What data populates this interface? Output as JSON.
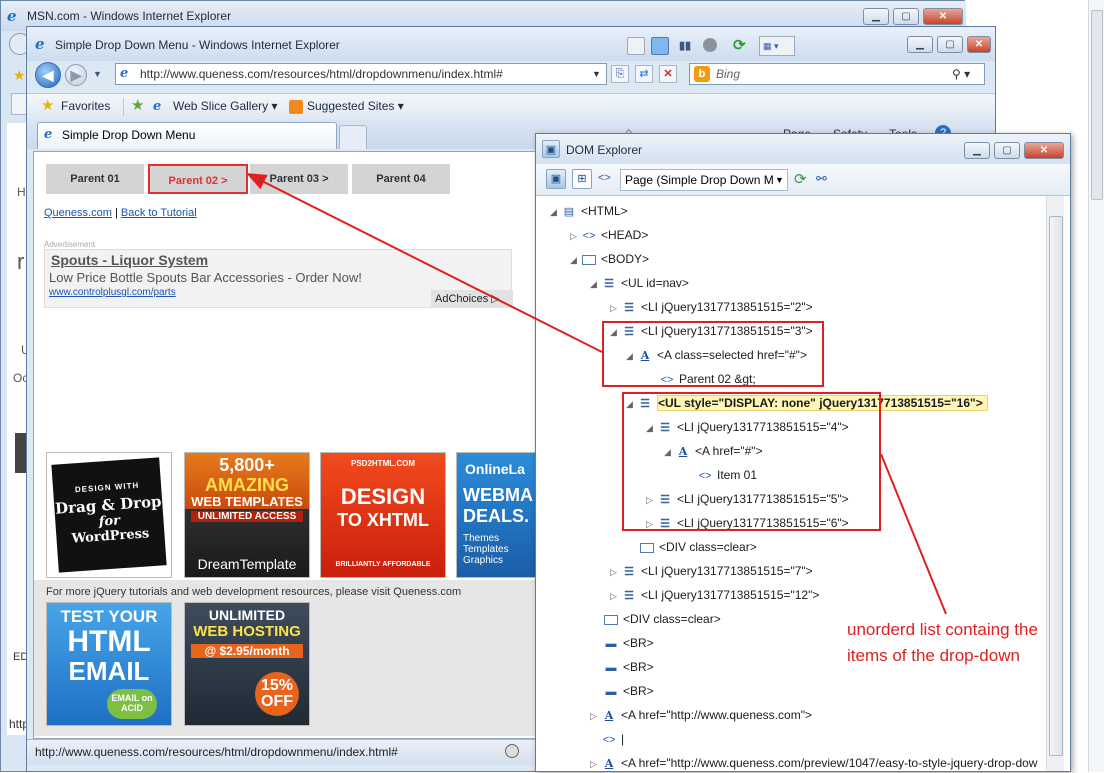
{
  "msn_window": {
    "title": "MSN.com - Windows Internet Explorer",
    "side_fragments": [
      "H",
      "r",
      "U",
      "Oc",
      "ED",
      "http"
    ]
  },
  "ie_window": {
    "title": "Simple Drop Down Menu - Windows Internet Explorer",
    "address": "http://www.queness.com/resources/html/dropdownmenu/index.html#",
    "search_placeholder": "Bing",
    "favorites_label": "Favorites",
    "web_slice_label": "Web Slice Gallery",
    "suggested_sites_label": "Suggested Sites",
    "tab_label": "Simple Drop Down Menu",
    "commandbar_fragments": [
      "Page",
      "Safety",
      "Tools"
    ],
    "status_url": "http://www.queness.com/resources/html/dropdownmenu/index.html#"
  },
  "page": {
    "menu": [
      "Parent 01",
      "Parent 02 >",
      "Parent 03 >",
      "Parent 04"
    ],
    "links": [
      "Queness.com",
      "Back to Tutorial"
    ],
    "link_separator": "|",
    "ad_label": "Advertisement",
    "ad": {
      "title": "Spouts - Liquor System",
      "description": "Low Price Bottle Spouts Bar Accessories - Order Now!",
      "url": "www.controlplusgl.com/parts",
      "choices": "AdChoices"
    },
    "banners": [
      {
        "top": "DESIGN WITH",
        "main": "Drag & Drop",
        "sub": "for",
        "foot": "WordPress"
      },
      {
        "top": "5,800+",
        "main": "AMAZING",
        "sub": "WEB TEMPLATES",
        "mid": "UNLIMITED ACCESS",
        "foot": "DreamTemplate"
      },
      {
        "top": "PSD2HTML.COM",
        "main": "DESIGN",
        "sub": "TO XHTML",
        "foot": "BRILLIANTLY AFFORDABLE"
      },
      {
        "top": "OnlineLa",
        "main": "WEBMA",
        "sub": "DEALS.",
        "foot": "Themes Templates Graphics"
      }
    ],
    "more_text": "For more jQuery tutorials and web development resources, please visit Queness.com",
    "banners2": [
      {
        "top": "TEST YOUR",
        "main": "HTML",
        "sub": "EMAIL",
        "foot": "EMAIL on ACID"
      },
      {
        "top": "UNLIMITED",
        "main": "WEB HOSTING",
        "sub": "@ $2.95/month",
        "foot": "15% OFF"
      }
    ]
  },
  "dom_explorer": {
    "title": "DOM Explorer",
    "page_select": "Page (Simple Drop Down M",
    "nodes": [
      "<HTML>",
      "<HEAD>",
      "<BODY>",
      "<UL id=nav>",
      "<LI jQuery1317713851515=\"2\">",
      "<LI jQuery1317713851515=\"3\">",
      "<A class=selected href=\"#\">",
      "Parent 02 &gt;",
      "<UL style=\"DISPLAY: none\" jQuery1317713851515=\"16\">",
      "<LI jQuery1317713851515=\"4\">",
      "<A href=\"#\">",
      "Item 01",
      "<LI jQuery1317713851515=\"5\">",
      "<LI jQuery1317713851515=\"6\">",
      "<DIV class=clear>",
      "<LI jQuery1317713851515=\"7\">",
      "<LI jQuery1317713851515=\"12\">",
      "<DIV class=clear>",
      "<BR>",
      "<BR>",
      "<BR>",
      "<A href=\"http://www.queness.com\">",
      "|",
      "<A href=\"http://www.queness.com/preview/1047/easy-to-style-jquery-drop-dow"
    ]
  },
  "annotation": "unorderd list containg the items of the drop-down",
  "colors": {
    "annotation": "#e02020",
    "highlight": "#fff6b3"
  }
}
